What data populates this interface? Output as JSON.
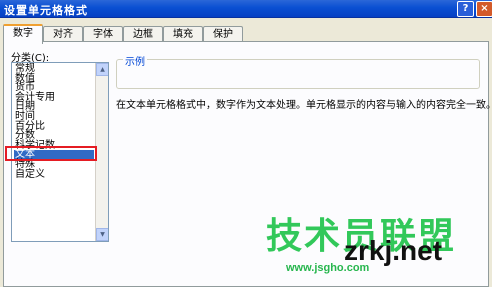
{
  "window": {
    "title": "设置单元格格式",
    "help": "?",
    "close": "×"
  },
  "tabs": [
    "数字",
    "对齐",
    "字体",
    "边框",
    "填充",
    "保护"
  ],
  "category_label": "分类(C):",
  "categories": [
    "常规",
    "数值",
    "货币",
    "会计专用",
    "日期",
    "时间",
    "百分比",
    "分数",
    "科学记数",
    "文本",
    "特殊",
    "自定义"
  ],
  "selected_category": "文本",
  "sample": {
    "legend": "示例"
  },
  "description": "在文本单元格格式中，数字作为文本处理。单元格显示的内容与输入的内容完全一致。",
  "watermark": {
    "cn": "技术员联盟",
    "site": "zrkj.net",
    "url": "www.jsgho.com"
  },
  "colors": {
    "title_bar": "#0a4fd2",
    "selection": "#316ac5",
    "highlight_box": "#e51c23",
    "watermark": "#32c85a"
  }
}
